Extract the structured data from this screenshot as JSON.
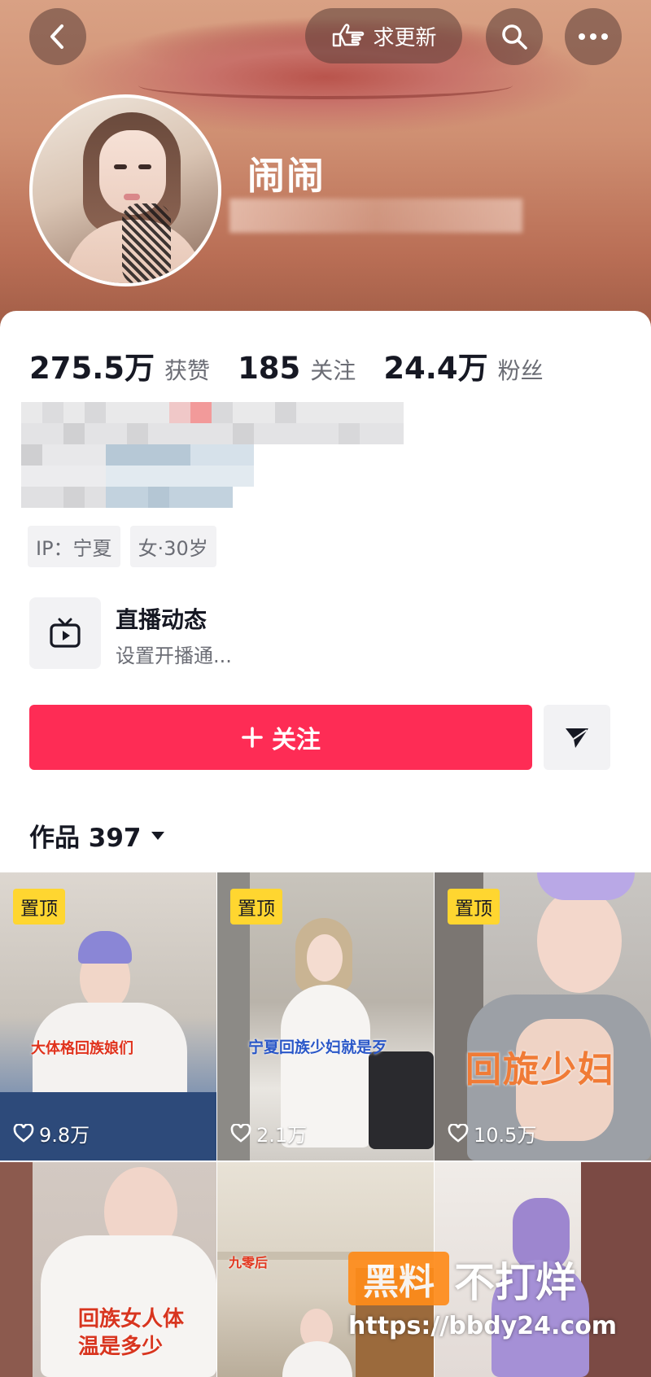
{
  "header": {
    "update_label": "求更新",
    "back_icon": "back-chevron-icon",
    "search_icon": "search-icon",
    "more_icon": "more-icon",
    "hand_icon": "pointing-hand-icon"
  },
  "profile": {
    "nickname": "闹闹",
    "stats": [
      {
        "value": "275.5万",
        "label": "获赞"
      },
      {
        "value": "185",
        "label": "关注"
      },
      {
        "value": "24.4万",
        "label": "粉丝"
      }
    ],
    "tags": [
      "IP：宁夏",
      "女·30岁"
    ]
  },
  "live": {
    "title": "直播动态",
    "subtitle": "设置开播通..."
  },
  "actions": {
    "follow_label": "关注",
    "follow_color": "#fe2c55"
  },
  "works": {
    "label": "作品 397"
  },
  "videos": [
    {
      "pinned": "置顶",
      "likes": "9.8万",
      "caption": "大体格回族娘们"
    },
    {
      "pinned": "置顶",
      "likes": "2.1万",
      "caption": "宁夏回族少妇就是歹"
    },
    {
      "pinned": "置顶",
      "likes": "10.5万",
      "caption": "回旋少妇"
    },
    {
      "pinned": "",
      "likes": "",
      "caption": "回族女人体温是多少"
    },
    {
      "pinned": "",
      "likes": "",
      "caption": "九零后"
    },
    {
      "pinned": "",
      "likes": "",
      "caption": ""
    }
  ],
  "watermark": {
    "box": "黑料",
    "text": "不打烊",
    "url": "https://bbdy24.com"
  }
}
